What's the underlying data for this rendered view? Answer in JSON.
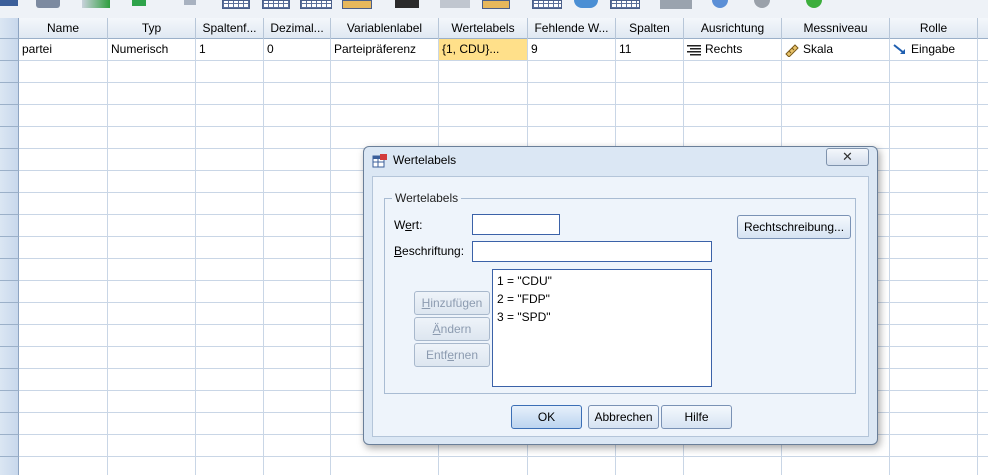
{
  "grid": {
    "columns": [
      "Name",
      "Typ",
      "Spaltenf...",
      "Dezimal...",
      "Variablenlabel",
      "Wertelabels",
      "Fehlende W...",
      "Spalten",
      "Ausrichtung",
      "Messniveau",
      "Rolle"
    ],
    "rows": [
      {
        "name": "partei",
        "typ": "Numerisch",
        "spaltenformat": "1",
        "dezimal": "0",
        "variablenlabel": "Parteipräferenz",
        "wertelabels": "{1, CDU}...",
        "fehlende": "9",
        "spalten": "11",
        "ausrichtung": "Rechts",
        "messniveau": "Skala",
        "rolle": "Eingabe"
      }
    ],
    "accent_selected": "#ffe08a"
  },
  "dialog": {
    "title": "Wertelabels",
    "close_glyph": "✕",
    "group_label": "Wertelabels",
    "wert_label_pre": "W",
    "wert_label_u": "e",
    "wert_label_post": "rt:",
    "beschriftung_label_u": "B",
    "beschriftung_label_post": "eschriftung:",
    "wert_value": "",
    "beschriftung_value": "",
    "spelling_button": "Rechtschreibung...",
    "add_button_u": "H",
    "add_button_post": "inzufügen",
    "change_button_u": "Ä",
    "change_button_post": "ndern",
    "remove_button_pre": "Entf",
    "remove_button_u": "e",
    "remove_button_post": "rnen",
    "list": [
      "1 = \"CDU\"",
      "2 = \"FDP\"",
      "3 = \"SPD\""
    ],
    "ok_button": "OK",
    "cancel_button": "Abbrechen",
    "help_button": "Hilfe"
  },
  "icons": {
    "ausrichtung": "align-right-icon",
    "messniveau": "ruler-icon",
    "rolle": "input-arrow-icon",
    "dialog": "value-labels-icon"
  }
}
